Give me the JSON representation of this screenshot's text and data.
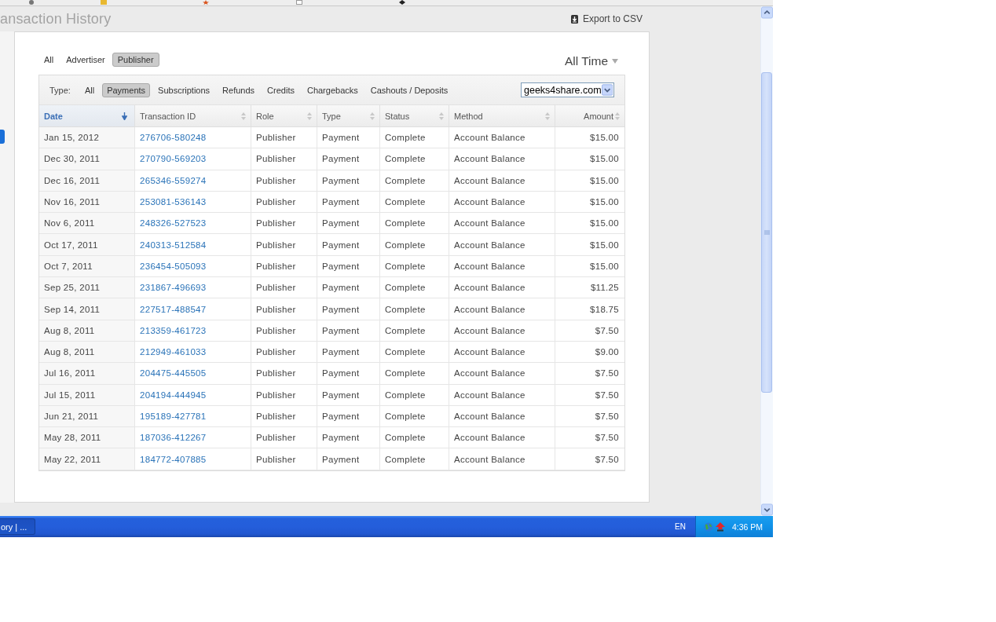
{
  "page_header": {
    "title": "ansaction History",
    "export_link": "Export to CSV"
  },
  "role_filter": [
    {
      "label": "All",
      "selected": false
    },
    {
      "label": "Advertiser",
      "selected": false
    },
    {
      "label": "Publisher",
      "selected": true
    }
  ],
  "period_menu": {
    "label": "All Time"
  },
  "type_filter": {
    "label": "Type:",
    "options": [
      {
        "label": "All",
        "selected": false
      },
      {
        "label": "Payments",
        "selected": true
      },
      {
        "label": "Subscriptions",
        "selected": false
      },
      {
        "label": "Refunds",
        "selected": false
      },
      {
        "label": "Credits",
        "selected": false
      },
      {
        "label": "Chargebacks",
        "selected": false
      },
      {
        "label": "Cashouts / Deposits",
        "selected": false
      }
    ]
  },
  "site_select": {
    "value": "geeks4share.com"
  },
  "table": {
    "columns": [
      {
        "label": "Date",
        "kind": "text",
        "sorted": true
      },
      {
        "label": "Transaction ID",
        "kind": "link",
        "sorted": false
      },
      {
        "label": "Role",
        "kind": "text",
        "sorted": false
      },
      {
        "label": "Type",
        "kind": "text",
        "sorted": false
      },
      {
        "label": "Status",
        "kind": "text",
        "sorted": false
      },
      {
        "label": "Method",
        "kind": "text",
        "sorted": false
      },
      {
        "label": "Amount",
        "kind": "money",
        "sorted": false
      }
    ],
    "rows": [
      [
        "Jan 15, 2012",
        "276706-580248",
        "Publisher",
        "Payment",
        "Complete",
        "Account Balance",
        "$15.00"
      ],
      [
        "Dec 30, 2011",
        "270790-569203",
        "Publisher",
        "Payment",
        "Complete",
        "Account Balance",
        "$15.00"
      ],
      [
        "Dec 16, 2011",
        "265346-559274",
        "Publisher",
        "Payment",
        "Complete",
        "Account Balance",
        "$15.00"
      ],
      [
        "Nov 16, 2011",
        "253081-536143",
        "Publisher",
        "Payment",
        "Complete",
        "Account Balance",
        "$15.00"
      ],
      [
        "Nov 6, 2011",
        "248326-527523",
        "Publisher",
        "Payment",
        "Complete",
        "Account Balance",
        "$15.00"
      ],
      [
        "Oct 17, 2011",
        "240313-512584",
        "Publisher",
        "Payment",
        "Complete",
        "Account Balance",
        "$15.00"
      ],
      [
        "Oct 7, 2011",
        "236454-505093",
        "Publisher",
        "Payment",
        "Complete",
        "Account Balance",
        "$15.00"
      ],
      [
        "Sep 25, 2011",
        "231867-496693",
        "Publisher",
        "Payment",
        "Complete",
        "Account Balance",
        "$11.25"
      ],
      [
        "Sep 14, 2011",
        "227517-488547",
        "Publisher",
        "Payment",
        "Complete",
        "Account Balance",
        "$18.75"
      ],
      [
        "Aug 8, 2011",
        "213359-461723",
        "Publisher",
        "Payment",
        "Complete",
        "Account Balance",
        "$7.50"
      ],
      [
        "Aug 8, 2011",
        "212949-461033",
        "Publisher",
        "Payment",
        "Complete",
        "Account Balance",
        "$9.00"
      ],
      [
        "Jul 16, 2011",
        "204475-445505",
        "Publisher",
        "Payment",
        "Complete",
        "Account Balance",
        "$7.50"
      ],
      [
        "Jul 15, 2011",
        "204194-444945",
        "Publisher",
        "Payment",
        "Complete",
        "Account Balance",
        "$7.50"
      ],
      [
        "Jun 21, 2011",
        "195189-427781",
        "Publisher",
        "Payment",
        "Complete",
        "Account Balance",
        "$7.50"
      ],
      [
        "May 28, 2011",
        "187036-412267",
        "Publisher",
        "Payment",
        "Complete",
        "Account Balance",
        "$7.50"
      ],
      [
        "May 22, 2011",
        "184772-407885",
        "Publisher",
        "Payment",
        "Complete",
        "Account Balance",
        "$7.50"
      ]
    ]
  },
  "taskbar": {
    "task_button": "ory | ...",
    "language": "EN",
    "clock": "4:36 PM"
  }
}
